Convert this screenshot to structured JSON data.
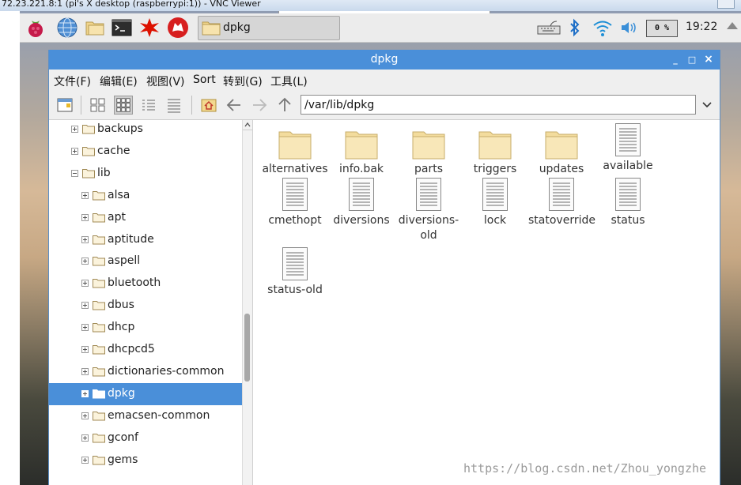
{
  "vnc": {
    "title": "72.23.221.8:1 (pi's X desktop (raspberrypi:1)) - VNC Viewer"
  },
  "taskbar": {
    "task_label": "dpkg",
    "cpu": "0 %",
    "clock": "19:22",
    "icons": [
      "raspberry-menu-icon",
      "web-browser-icon",
      "file-manager-icon",
      "terminal-icon",
      "mathematica-icon",
      "wolfram-icon"
    ]
  },
  "window": {
    "title": "dpkg",
    "controls": {
      "minimize": "_",
      "maximize": "□",
      "close": "×"
    },
    "menu": [
      "文件(F)",
      "编辑(E)",
      "视图(V)",
      "Sort",
      "转到(G)",
      "工具(L)"
    ],
    "path": "/var/lib/dpkg"
  },
  "sidebar": {
    "items": [
      {
        "label": "backups",
        "level": 0,
        "expander": "plus",
        "selected": false
      },
      {
        "label": "cache",
        "level": 0,
        "expander": "plus",
        "selected": false
      },
      {
        "label": "lib",
        "level": 0,
        "expander": "minus",
        "selected": false
      },
      {
        "label": "alsa",
        "level": 1,
        "expander": "plus",
        "selected": false
      },
      {
        "label": "apt",
        "level": 1,
        "expander": "plus",
        "selected": false
      },
      {
        "label": "aptitude",
        "level": 1,
        "expander": "plus",
        "selected": false
      },
      {
        "label": "aspell",
        "level": 1,
        "expander": "plus",
        "selected": false
      },
      {
        "label": "bluetooth",
        "level": 1,
        "expander": "plus",
        "selected": false
      },
      {
        "label": "dbus",
        "level": 1,
        "expander": "plus",
        "selected": false
      },
      {
        "label": "dhcp",
        "level": 1,
        "expander": "plus",
        "selected": false
      },
      {
        "label": "dhcpcd5",
        "level": 1,
        "expander": "plus",
        "selected": false
      },
      {
        "label": "dictionaries-common",
        "level": 1,
        "expander": "plus",
        "selected": false
      },
      {
        "label": "dpkg",
        "level": 1,
        "expander": "plus",
        "selected": true
      },
      {
        "label": "emacsen-common",
        "level": 1,
        "expander": "plus",
        "selected": false
      },
      {
        "label": "gconf",
        "level": 1,
        "expander": "plus",
        "selected": false
      },
      {
        "label": "gems",
        "level": 1,
        "expander": "plus",
        "selected": false
      }
    ]
  },
  "content": {
    "items": [
      {
        "name": "alternatives",
        "type": "folder"
      },
      {
        "name": "info.bak",
        "type": "folder"
      },
      {
        "name": "parts",
        "type": "folder"
      },
      {
        "name": "triggers",
        "type": "folder"
      },
      {
        "name": "updates",
        "type": "folder"
      },
      {
        "name": "available",
        "type": "file"
      },
      {
        "name": "cmethopt",
        "type": "file"
      },
      {
        "name": "diversions",
        "type": "file"
      },
      {
        "name": "diversions-old",
        "type": "file"
      },
      {
        "name": "lock",
        "type": "file"
      },
      {
        "name": "statoverride",
        "type": "file"
      },
      {
        "name": "status",
        "type": "file"
      },
      {
        "name": "status-old",
        "type": "file"
      }
    ]
  },
  "watermark": "https://blog.csdn.net/Zhou_yongzhe",
  "colors": {
    "accent": "#4a8fd9",
    "folder": "#f5dea0"
  }
}
